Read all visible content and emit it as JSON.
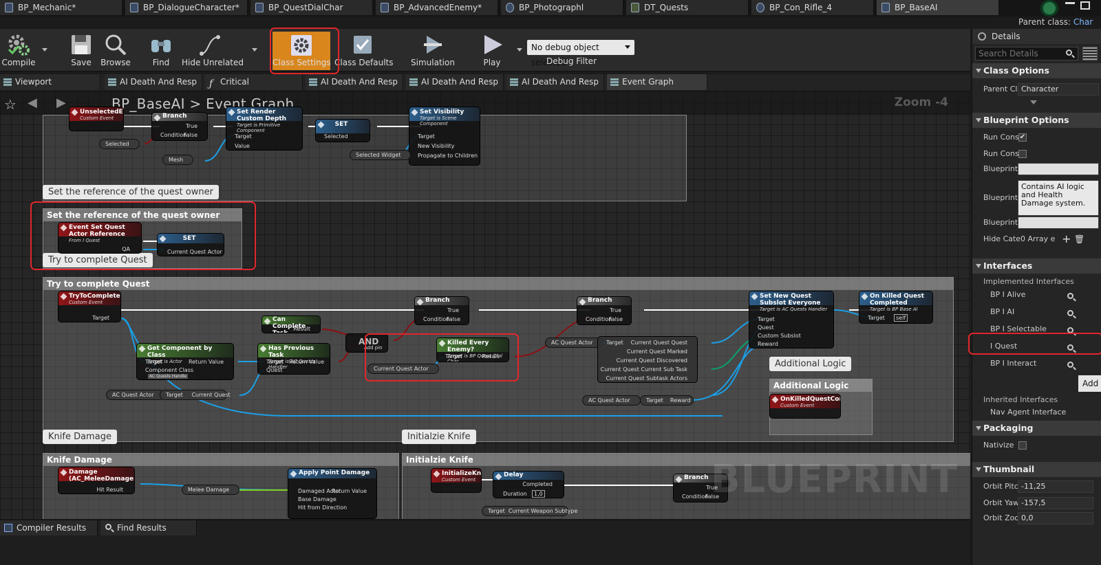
{
  "tabs": [
    "BP_Mechanic*",
    "BP_DialogueCharacter*",
    "BP_QuestDialChar",
    "BP_AdvancedEnemy*",
    "BP_Photographl",
    "DT_Quests",
    "BP_Con_Rifle_4",
    "BP_BaseAI"
  ],
  "parent_class": {
    "label": "Parent class:",
    "value": "Char"
  },
  "toolbar": {
    "compile": "Compile",
    "save": "Save",
    "browse": "Browse",
    "find": "Find",
    "hide_unrelated": "Hide Unrelated",
    "class_settings": "Class Settings",
    "class_defaults": "Class Defaults",
    "simulation": "Simulation",
    "play": "Play",
    "debug_object": "No debug object selected",
    "debug_filter": "Debug Filter"
  },
  "subtabs": [
    "Viewport",
    "AI Death And Resp",
    "Critical",
    "AI Death And Resp",
    "AI Death And Resp",
    "AI Death And Resp",
    "Event Graph"
  ],
  "breadcrumb": {
    "blueprint": "BP_BaseAI",
    "sep": ">",
    "graph": "Event Graph"
  },
  "zoom": "Zoom -4",
  "watermark": "BLUEPRINT",
  "graph": {
    "bubble1": "Set the reference of the quest owner",
    "comment1": "Set the reference of the quest owner",
    "bubble2": "Try to complete Quest",
    "comment2": "Try to complete Quest",
    "bubble3": "Additional Logic",
    "comment3": "Additional Logic",
    "bubble4": "Knife Damage",
    "comment4": "Knife Damage",
    "bubble5": "Initialzie Knife",
    "comment5": "Initialzie Knife",
    "nodes": {
      "unselected": {
        "title": "UnselectedEvent",
        "sub": "Custom Event"
      },
      "branch1": {
        "title": "Branch",
        "t": "True",
        "c": "Condition",
        "f": "False"
      },
      "render_depth": {
        "title": "Set Render Custom Depth",
        "sub": "Target is Primitive Component",
        "target": "Target",
        "value": "Value"
      },
      "set1": {
        "title": "SET",
        "pin": "Selected"
      },
      "visibility": {
        "title": "Set Visibility",
        "sub": "Target is Scene Component",
        "target": "Target",
        "nv": "New Visibility",
        "prop": "Propagate to Children"
      },
      "selected_var": "Selected",
      "mesh_var": "Mesh",
      "selwidget_var": "Selected Widget",
      "set_quest_actor": {
        "title": "Event Set Quest Actor Reference",
        "sub": "From I Quest",
        "qa": "QA"
      },
      "set2": {
        "title": "SET",
        "pin": "Current Quest Actor"
      },
      "try_complete": {
        "title": "TryToCompleteQuest",
        "sub": "Custom Event",
        "target": "Target"
      },
      "can_complete": {
        "title": "Can Complete Task",
        "result": "Result"
      },
      "get_comp": {
        "title": "Get Component by Class",
        "sub": "Target is Actor",
        "target": "Target",
        "rv": "Return Value",
        "cc": "Component Class",
        "ccv": "AC Quests Handle"
      },
      "has_prev": {
        "title": "Has Previous Task",
        "sub": "Target is AC Quests Handler",
        "target": "Target",
        "rv": "Return Value",
        "quest": "Quest"
      },
      "and": {
        "title": "AND",
        "add": "Add pin"
      },
      "branch2": {
        "title": "Branch",
        "t": "True",
        "c": "Condition",
        "f": "False"
      },
      "killed": {
        "title": "Killed Every Enemy?",
        "sub": "Target is BP Quest Dial Char",
        "target": "Target",
        "result": "Result"
      },
      "cqa_var": "Current Quest Actor",
      "branch3": {
        "title": "Branch",
        "t": "True",
        "c": "Condition",
        "f": "False"
      },
      "acqa_var1": "AC Quest Actor",
      "break_node": {
        "target": "Target",
        "o1": "Current Quest Quest",
        "o2": "Current Quest Marked",
        "o3": "Current Quest Discovered",
        "o4": "Current Quest Current Sub Task",
        "o5": "Current Quest Subtask Actors"
      },
      "set_subslot": {
        "title": "Set New Quest Subslot Everyone",
        "sub": "Target is AC Quests Handler",
        "target": "Target",
        "quest": "Quest",
        "cs": "Custom Subslot",
        "reward": "Reward"
      },
      "on_killed": {
        "title": "On Killed Quest Completed",
        "sub": "Target is BP Base AI",
        "target": "Target",
        "self": "self"
      },
      "acqa_var2": "AC Quest Actor",
      "target_cq": {
        "a": "Target",
        "b": "Current Quest"
      },
      "acqa_var3": "AC Quest Actor",
      "target_rw": {
        "a": "Target",
        "b": "Reward"
      },
      "on_killed_evt": {
        "title": "OnKilledQuestCompleted",
        "sub": "Custom Event"
      },
      "damage": {
        "title": "Damage (AC_MeleeDamage)",
        "hit": "Hit Result"
      },
      "melee_var": "Melee Damage",
      "apply_dmg": {
        "title": "Apply Point Damage",
        "da": "Damaged Actor",
        "bd": "Base Damage",
        "hd": "Hit from Direction",
        "rv": "Return Value"
      },
      "init_knife": {
        "title": "InitializeKnife",
        "sub": "Custom Event"
      },
      "delay": {
        "title": "Delay",
        "completed": "Completed",
        "duration": "Duration",
        "dv": "1,0"
      },
      "branch4": {
        "title": "Branch",
        "t": "True",
        "c": "Condition",
        "f": "False"
      },
      "target_cws": {
        "a": "Target",
        "b": "Current Weapon Subtype"
      }
    }
  },
  "details": {
    "title": "Details",
    "search_placeholder": "Search Details",
    "class_options": "Class Options",
    "parent_class_label": "Parent Cla",
    "parent_class_value": "Character",
    "blueprint_options": "Blueprint Options",
    "run_cons1": "Run Cons",
    "run_cons2": "Run Cons",
    "bp1": "Blueprint",
    "bp2": "Blueprint",
    "bp3": "Blueprint",
    "bp2_text": "Contains AI logic and Health Damage system.",
    "hide_cate": "Hide Cate",
    "hide_cate_value": "0 Array e",
    "interfaces": "Interfaces",
    "implemented": "Implemented Interfaces",
    "iface_list": [
      "BP I Alive",
      "BP I AI",
      "BP I Selectable",
      "I Quest",
      "BP I Interact"
    ],
    "add": "Add",
    "inherited": "Inherited Interfaces",
    "nav_agent": "Nav Agent Interface",
    "packaging": "Packaging",
    "nativize": "Nativize",
    "thumbnail": "Thumbnail",
    "orbit_pitch": "Orbit Pitcl",
    "orbit_pitch_v": "-11,25",
    "orbit_yaw": "Orbit Yaw",
    "orbit_yaw_v": "-157,5",
    "orbit_zoom": "Orbit Zoo",
    "orbit_zoom_v": "0,0"
  },
  "bottom": {
    "compiler": "Compiler Results",
    "find": "Find Results"
  },
  "colors": {
    "exec": "#ffffff",
    "object": "#1aa0e8",
    "bool": "#8c0f12",
    "struct": "#0aa06e",
    "accent_orange": "#e08a1e",
    "highlight": "#e0262b"
  }
}
